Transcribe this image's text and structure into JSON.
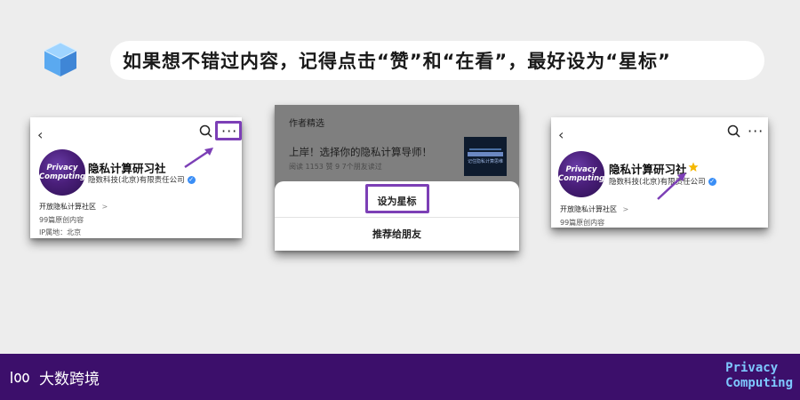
{
  "banner": {
    "text": "如果想不错过内容，记得点击“赞”和“在看”，最好设为“星标”"
  },
  "colors": {
    "highlight": "#7c3fb6",
    "footer_bg": "#3c0f6b",
    "brand_text": "#7ec8ff",
    "verify": "#3a8ef6",
    "star": "#f5b800"
  },
  "icons": [
    "cube-icon",
    "back-arrow-icon",
    "search-icon",
    "more-icon",
    "verified-icon",
    "star-icon",
    "arrow-icon"
  ],
  "profile": {
    "avatar_line1": "Privacy",
    "avatar_line2": "Computing",
    "name": "隐私计算研习社",
    "company": "隐数科技(北京)有限责任公司",
    "community": "开放隐私计算社区",
    "chevron": ">",
    "original_count": "99篇原创内容",
    "ip": "IP属地：北京",
    "more": "···"
  },
  "middle": {
    "section_title": "作者精选",
    "article_title": "上岸！选择你的隐私计算导师！",
    "article_meta": "阅读 1153  赞 9  7个朋友读过",
    "thumb_text": "记住隐私计算思维",
    "set_star": "设为星标",
    "recommend": "推荐给朋友"
  },
  "footer": {
    "logo_text": "大数跨境",
    "brand_line1": "Privacy",
    "brand_line2": "Computing"
  }
}
